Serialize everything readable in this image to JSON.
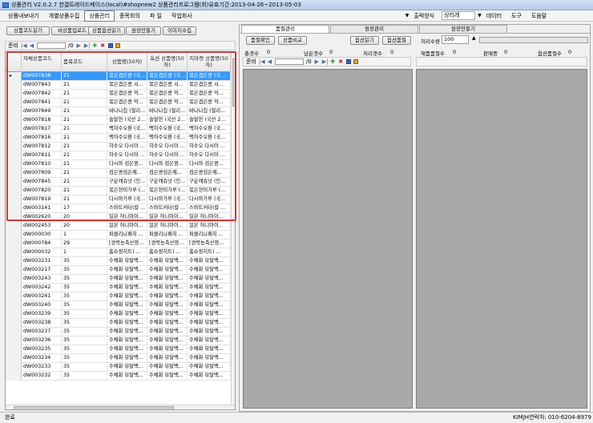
{
  "window": {
    "title": "상품관리 V2.0.2.7 한결트레이드베이스(local)#shopnew2 상품관리프로그램(회)유효기간:2013-04-26~2013-05-03"
  },
  "menu": {
    "items": [
      "상품내보내기",
      "개별상품수집",
      "상품관리",
      "종목회의",
      "파 일",
      "작업회사"
    ],
    "order_label": "출력양식",
    "order_value": "상리레",
    "data_label": "데이터",
    "tools_label": "도구",
    "help_label": "도움말"
  },
  "left": {
    "buttons": [
      "상품코드읽기",
      "비상품업로드",
      "상품옵션읽기",
      "원장만들기",
      "이미지수집"
    ],
    "nav": {
      "label": "준비",
      "page": "/0"
    },
    "columns": [
      "자체상품코드",
      "품목코드",
      "상품명(50자)",
      "옥션 상품명(50자)",
      "지마켓 상품명(50자)"
    ]
  },
  "rows": [
    {
      "code": "dW007838",
      "cat": "21",
      "n1": "볶은겹은콩 (국...",
      "n2": "볶은겹은콩 (국...",
      "n3": "볶은겹은콩 (국...",
      "selected": true
    },
    {
      "code": "dW007843",
      "cat": "21",
      "n1": "볶은겹은콩 서...",
      "n2": "볶은겹은콩 서...",
      "n3": "볶은겹은콩 서..."
    },
    {
      "code": "dW007842",
      "cat": "21",
      "n1": "볶은겹은콩 악...",
      "n2": "볶은겹은콩 악...",
      "n3": "볶은겹은콩 악..."
    },
    {
      "code": "dW007841",
      "cat": "21",
      "n1": "볶은겹은콩 악...",
      "n2": "볶은겹은콩 악...",
      "n3": "볶은겹은콩 악..."
    },
    {
      "code": "dW007849",
      "cat": "21",
      "n1": "바나나칩 (필리...",
      "n2": "바나나칩 (필리...",
      "n3": "바나나칩 (필리..."
    },
    {
      "code": "dW007818",
      "cat": "21",
      "n1": "슬말한 (국산 2...",
      "n2": "슬말한 (국산 2...",
      "n3": "슬말한 (국산 2..."
    },
    {
      "code": "dW007817",
      "cat": "21",
      "n1": "백하수오환 (국...",
      "n2": "백하수오환 (국...",
      "n3": "백하수오환 (국..."
    },
    {
      "code": "dW007816",
      "cat": "21",
      "n1": "백하수오환 (국...",
      "n2": "백하수오환 (국...",
      "n3": "백하수오환 (국..."
    },
    {
      "code": "dW007812",
      "cat": "21",
      "n1": "하수오 다시마 ...",
      "n2": "하수오 다시마 ...",
      "n3": "하수오 다시마 ..."
    },
    {
      "code": "dW007811",
      "cat": "21",
      "n1": "하수오 다시마 ...",
      "n2": "하수오 다시마 ...",
      "n3": "하수오 다시마 ..."
    },
    {
      "code": "dW007810",
      "cat": "21",
      "n1": "다시마 검은콩...",
      "n2": "다시마 검은콩...",
      "n3": "다시마 검은콩..."
    },
    {
      "code": "dW007809",
      "cat": "21",
      "n1": "검은콩검은깨...",
      "n2": "검은콩검은깨...",
      "n3": "검은콩검은깨..."
    },
    {
      "code": "dW007845",
      "cat": "21",
      "n1": "구운캐슈넛 (인...",
      "n2": "구운캐슈넛 (인...",
      "n3": "구운캐슈넛 (인..."
    },
    {
      "code": "dW007820",
      "cat": "21",
      "n1": "볶은현미가루 (...",
      "n2": "볶은현미가루 (...",
      "n3": "볶은현미가루 (..."
    },
    {
      "code": "dW007819",
      "cat": "21",
      "n1": "다시마가루 (국...",
      "n2": "다시마가루 (국...",
      "n3": "다시마가루 (국..."
    },
    {
      "code": "dW003141",
      "cat": "17",
      "n1": "스마트커터(칼 ...",
      "n2": "스마트커터(칼 ...",
      "n3": "스마트커터(칼 ..."
    },
    {
      "code": "dW002620",
      "cat": "20",
      "n1": "일본 허니마이...",
      "n2": "일본 허니마이...",
      "n3": "일본 허니마이..."
    },
    {
      "code": "dW002453",
      "cat": "20",
      "n1": "일본 허니마이...",
      "n2": "일본 허니마이...",
      "n3": "일본 허니마이..."
    },
    {
      "code": "dW000030",
      "cat": "1",
      "n1": "파클리나패치 ...",
      "n2": "파클리나패치 ...",
      "n3": "파클리나패치 ..."
    },
    {
      "code": "dW000784",
      "cat": "29",
      "n1": "[경북농축산영...",
      "n2": "[경북농축산영...",
      "n3": "[경북농축산영..."
    },
    {
      "code": "dW000032",
      "cat": "1",
      "n1": "홈쇼핑히트) ...",
      "n2": "홈쇼핑히트) ...",
      "n3": "홈쇼핑히트) ..."
    },
    {
      "code": "dW003231",
      "cat": "35",
      "n1": "수채화 뮤탈백...",
      "n2": "수채화 뮤탈백...",
      "n3": "수채화 뮤탈백..."
    },
    {
      "code": "dW003217",
      "cat": "35",
      "n1": "수채화 뮤탈백...",
      "n2": "수채화 뮤탈백...",
      "n3": "수채화 뮤탈백..."
    },
    {
      "code": "dW003243",
      "cat": "35",
      "n1": "수채화 뮤탈백...",
      "n2": "수채화 뮤탈백...",
      "n3": "수채화 뮤탈백..."
    },
    {
      "code": "dW003242",
      "cat": "35",
      "n1": "수채화 뮤탈백...",
      "n2": "수채화 뮤탈백...",
      "n3": "수채화 뮤탈백..."
    },
    {
      "code": "dW003241",
      "cat": "35",
      "n1": "수채화 뮤탈백...",
      "n2": "수채화 뮤탈백...",
      "n3": "수채화 뮤탈백..."
    },
    {
      "code": "dW003240",
      "cat": "35",
      "n1": "수채화 뮤탈백...",
      "n2": "수채화 뮤탈백...",
      "n3": "수채화 뮤탈백..."
    },
    {
      "code": "dW003239",
      "cat": "35",
      "n1": "수채화 뮤탈백...",
      "n2": "수채화 뮤탈백...",
      "n3": "수채화 뮤탈백..."
    },
    {
      "code": "dW003238",
      "cat": "35",
      "n1": "수채화 뮤탈백...",
      "n2": "수채화 뮤탈백...",
      "n3": "수채화 뮤탈백..."
    },
    {
      "code": "dW003237",
      "cat": "35",
      "n1": "수채화 뮤탈백...",
      "n2": "수채화 뮤탈백...",
      "n3": "수채화 뮤탈백..."
    },
    {
      "code": "dW003236",
      "cat": "35",
      "n1": "수채화 뮤탈백...",
      "n2": "수채화 뮤탈백...",
      "n3": "수채화 뮤탈백..."
    },
    {
      "code": "dW003235",
      "cat": "35",
      "n1": "수채화 뮤탈백...",
      "n2": "수채화 뮤탈백...",
      "n3": "수채화 뮤탈백..."
    },
    {
      "code": "dW003234",
      "cat": "35",
      "n1": "수채화 뮤탈백...",
      "n2": "수채화 뮤탈백...",
      "n3": "수채화 뮤탈백..."
    },
    {
      "code": "dW003233",
      "cat": "35",
      "n1": "수채화 뮤탈백...",
      "n2": "수채화 뮤탈백...",
      "n3": "수채화 뮤탈백..."
    },
    {
      "code": "dW003232",
      "cat": "35",
      "n1": "수채화 뮤탈백...",
      "n2": "수채화 뮤탈백...",
      "n3": "수채화 뮤탈백..."
    }
  ],
  "right": {
    "tabs": [
      "품절관리",
      "원장관리",
      "원장만들기"
    ],
    "btn_check": "품절확인",
    "btn_compare": "상품비교",
    "btn_read": "옵션읽기",
    "btn_soldout": "옵션품절",
    "threads_label": "처리수량",
    "threads_value": "100",
    "stats": [
      {
        "label": "총갯수",
        "value": "0"
      },
      {
        "label": "남은갯수",
        "value": "0"
      },
      {
        "label": "처리갯수",
        "value": "0"
      },
      {
        "label": "재품품절수",
        "value": "0"
      },
      {
        "label": "판매중",
        "value": "0"
      },
      {
        "label": "옵션품절수",
        "value": "0"
      }
    ],
    "nav": {
      "label": "준비",
      "page": "/0"
    }
  },
  "status": {
    "left": "완료",
    "right": "KIMJH연락처: 010-6204-8979"
  },
  "colors": {
    "highlight": "#cd3b3b",
    "selected_row": "#3399ff"
  }
}
